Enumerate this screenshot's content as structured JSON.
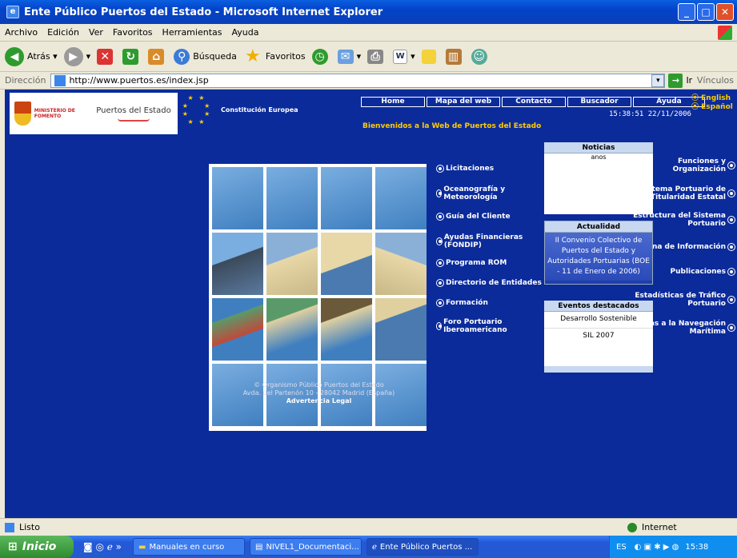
{
  "window": {
    "title": "Ente Público Puertos del Estado - Microsoft Internet Explorer"
  },
  "menu": [
    "Archivo",
    "Edición",
    "Ver",
    "Favoritos",
    "Herramientas",
    "Ayuda"
  ],
  "toolbar": {
    "back": "Atrás",
    "search": "Búsqueda",
    "favorites": "Favoritos"
  },
  "address": {
    "label": "Dirección",
    "url": "http://www.puertos.es/index.jsp",
    "go": "Ir",
    "links": "Vínculos"
  },
  "header": {
    "ministry": "MINISTERIO DE FOMENTO",
    "brand": "Puertos del Estado",
    "constitution": "Constitución Europea",
    "nav": [
      "Home",
      "Mapa del web",
      "Contacto",
      "Buscador",
      "Ayuda"
    ],
    "datetime": "15:38:51 22/11/2006",
    "lang": [
      "English",
      "Español"
    ],
    "welcome": "Bienvenidos a la Web de Puertos del Estado"
  },
  "left_links": [
    "Funciones y Organización",
    "El Sistema Portuario de Titularidad Estatal",
    "Estructura del Sistema Portuario",
    "Oficina de Información",
    "Publicaciones",
    "Estadísticas de Tráfico Portuario",
    "Ayudas a la Navegación Marítima"
  ],
  "right_links": [
    "Licitaciones",
    "Oceanografía y Meteorología",
    "Guía del Cliente",
    "Ayudas Financieras (FONDIP)",
    "Programa ROM",
    "Directorio de Entidades",
    "Formación",
    "Foro Portuario Iberoamericano"
  ],
  "panels": {
    "noticias": {
      "title": "Noticias",
      "text": "anos"
    },
    "actualidad": {
      "title": "Actualidad",
      "text": "II Convenio Colectivo de Puertos del Estado y Autoridades Portuarias (BOE - 11 de Enero de 2006)"
    },
    "eventos": {
      "title": "Eventos destacados",
      "items": [
        "Desarrollo Sostenible",
        "SIL 2007"
      ]
    }
  },
  "footer": {
    "line1": "© Organismo Público Puertos del Estado",
    "line2": "Avda. del Partenón 10 - 28042 Madrid (España)",
    "legal": "Advertencia Legal"
  },
  "status": {
    "text": "Listo",
    "zone": "Internet"
  },
  "taskbar": {
    "start": "Inicio",
    "items": [
      "Manuales en curso",
      "NIVEL1_Documentaci...",
      "Ente Público Puertos ..."
    ],
    "lang": "ES",
    "clock": "15:38"
  }
}
